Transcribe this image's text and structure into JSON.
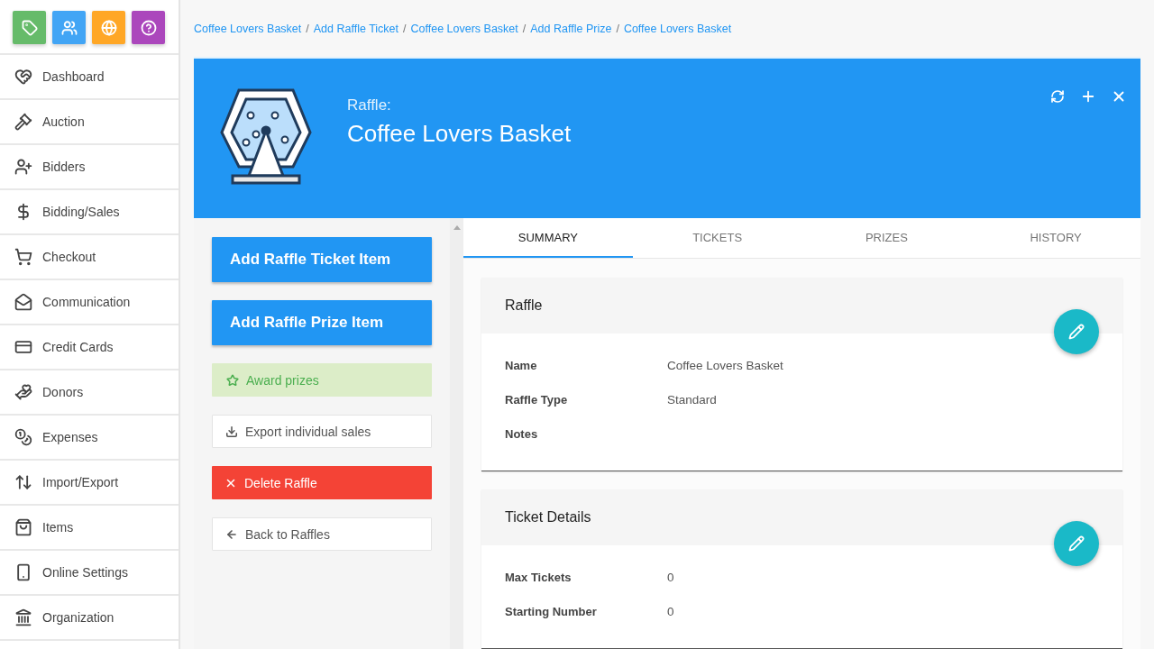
{
  "sidebar": {
    "shortcuts": [
      {
        "color": "#66bb6a"
      },
      {
        "color": "#42a5f5"
      },
      {
        "color": "#ffa726"
      },
      {
        "color": "#ab47bc"
      }
    ],
    "items": [
      {
        "label": "Dashboard"
      },
      {
        "label": "Auction"
      },
      {
        "label": "Bidders"
      },
      {
        "label": "Bidding/Sales"
      },
      {
        "label": "Checkout"
      },
      {
        "label": "Communication"
      },
      {
        "label": "Credit Cards"
      },
      {
        "label": "Donors"
      },
      {
        "label": "Expenses"
      },
      {
        "label": "Import/Export"
      },
      {
        "label": "Items"
      },
      {
        "label": "Online Settings"
      },
      {
        "label": "Organization"
      }
    ]
  },
  "breadcrumb": [
    {
      "label": "Coffee Lovers Basket"
    },
    {
      "separator": "/",
      "label": "Add Raffle Ticket"
    },
    {
      "separator": "/",
      "label": "Coffee Lovers Basket"
    },
    {
      "separator": "/",
      "label": "Add Raffle Prize"
    },
    {
      "separator": "/",
      "label": "Coffee Lovers Basket"
    }
  ],
  "header": {
    "label": "Raffle:",
    "title": "Coffee Lovers Basket"
  },
  "actions": [
    {
      "kind": "primary",
      "label": "Add Raffle Ticket Item"
    },
    {
      "kind": "primary",
      "label": "Add Raffle Prize Item"
    },
    {
      "kind": "success",
      "label": "Award prizes"
    },
    {
      "kind": "outline",
      "label": "Export individual sales"
    },
    {
      "kind": "danger",
      "label": "Delete Raffle"
    },
    {
      "kind": "outline",
      "label": "Back to Raffles"
    }
  ],
  "tabs": [
    {
      "label": "SUMMARY",
      "selected": true
    },
    {
      "label": "TICKETS",
      "selected": false
    },
    {
      "label": "PRIZES",
      "selected": false
    },
    {
      "label": "HISTORY",
      "selected": false
    }
  ],
  "cards": [
    {
      "title": "Raffle",
      "fields": [
        {
          "label": "Name",
          "value": "Coffee Lovers Basket"
        },
        {
          "label": "Raffle Type",
          "value": "Standard"
        },
        {
          "label": "Notes"
        }
      ]
    },
    {
      "title": "Ticket Details",
      "fields": [
        {
          "label": "Max Tickets",
          "value": "0"
        },
        {
          "label": "Starting Number",
          "value": "0"
        }
      ]
    }
  ]
}
